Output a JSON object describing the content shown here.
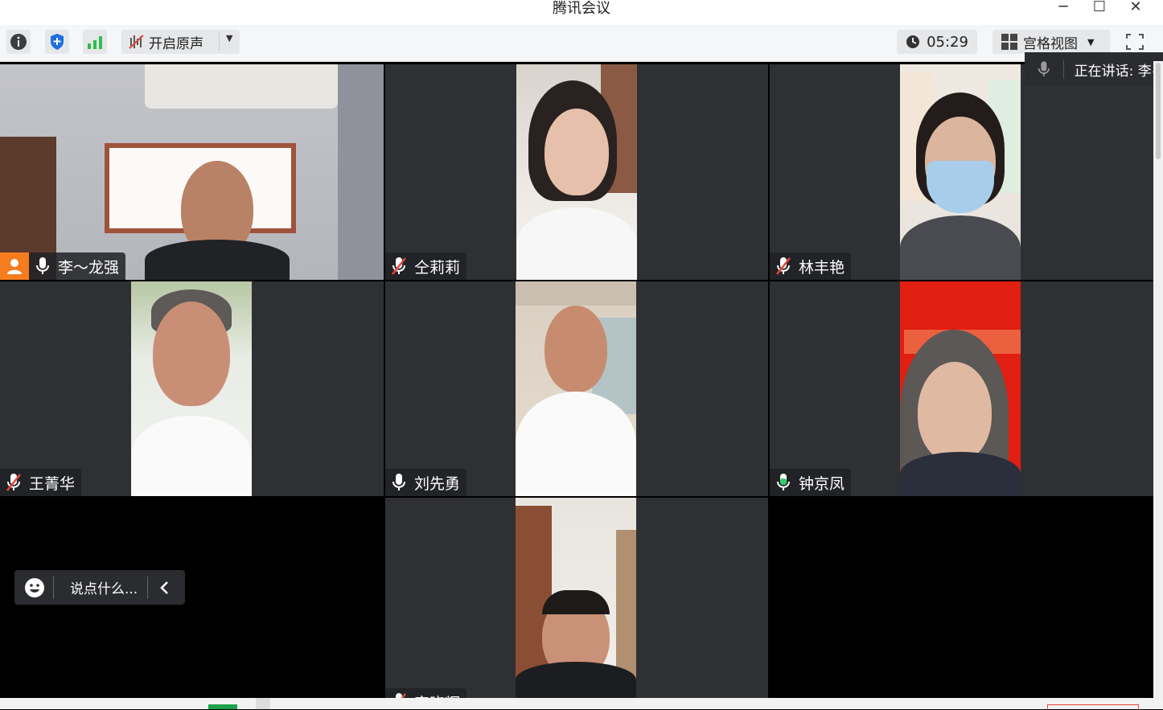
{
  "window": {
    "title": "腾讯会议",
    "minimize": "─",
    "maximize": "☐",
    "close": "✕"
  },
  "toolbar": {
    "original_sound_label": "开启原声",
    "timer": "05:29",
    "view_label": "宫格视图"
  },
  "speaker": {
    "label": "正在讲话: 李~"
  },
  "participants": [
    {
      "name": "李～龙强",
      "mic": "on",
      "host": true
    },
    {
      "name": "仝莉莉",
      "mic": "muted"
    },
    {
      "name": "林丰艳",
      "mic": "muted"
    },
    {
      "name": "王菁华",
      "mic": "muted"
    },
    {
      "name": "刘先勇",
      "mic": "on"
    },
    {
      "name": "钟京凤",
      "mic": "speaking"
    },
    {
      "name": "宋晓辉",
      "mic": "muted"
    }
  ],
  "chat": {
    "placeholder": "说点什么..."
  },
  "colors": {
    "active_speaker_border": "#2ecc71",
    "host_badge": "#f57c1f",
    "muted_mic": "#e8453c",
    "speaking_mic": "#2ecc71",
    "shield": "#1e6fe0",
    "signal": "#2fbf4f"
  }
}
